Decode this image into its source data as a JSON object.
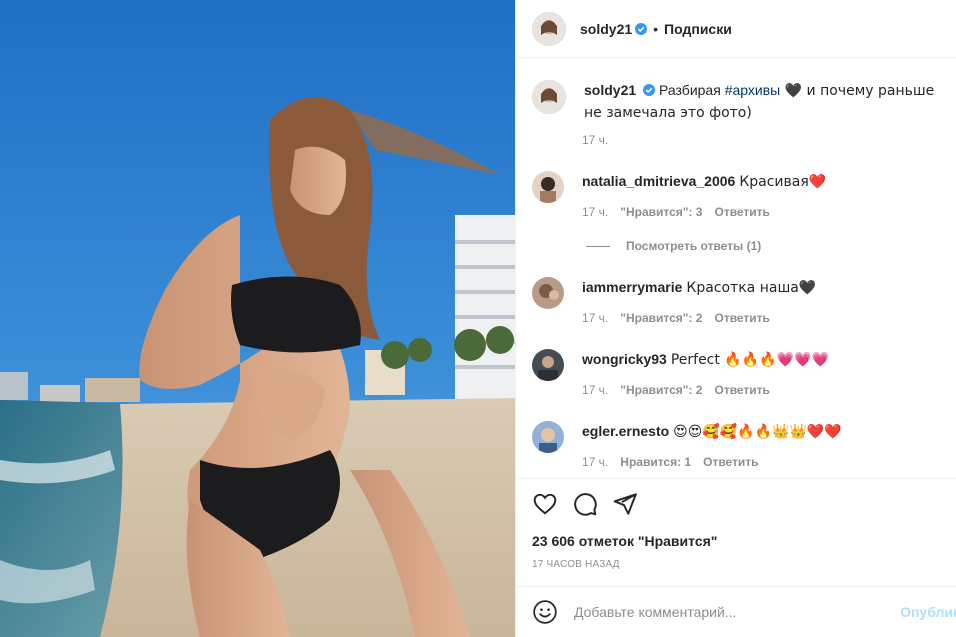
{
  "header": {
    "username": "soldy21",
    "dot": "•",
    "follow_label": "Подписки"
  },
  "caption": {
    "username": "soldy21",
    "text_before": " Разбирая ",
    "hashtag": "#архивы",
    "text_after": " 🖤 и почему раньше не замечала это фото)",
    "time": "17 ч."
  },
  "comments": [
    {
      "username": "natalia_dmitrieva_2006",
      "text": "Красивая❤️",
      "time": "17 ч.",
      "likes": "\"Нравится\": 3",
      "reply": "Ответить"
    },
    {
      "username": "iammerrymarie",
      "text": "Красотка наша🖤",
      "time": "17 ч.",
      "likes": "\"Нравится\": 2",
      "reply": "Ответить"
    },
    {
      "username": "wongricky93",
      "text": "Perfect 🔥🔥🔥💗💗💗",
      "time": "17 ч.",
      "likes": "\"Нравится\": 2",
      "reply": "Ответить"
    },
    {
      "username": "egler.ernesto",
      "text": "😍😍🥰🥰🔥🔥👑👑❤️❤️",
      "time": "17 ч.",
      "likes": "Нравится: 1",
      "reply": "Ответить"
    }
  ],
  "view_replies": "Посмотреть ответы (1)",
  "icons": {
    "like": "heart-icon",
    "comment": "comment-icon",
    "share": "share-icon",
    "emoji": "smile-icon",
    "verified": "verified-badge-icon"
  },
  "likes_count": "23 606 отметок \"Нравится\"",
  "timestamp": "17 ЧАСОВ НАЗАД",
  "add_comment": {
    "placeholder": "Добавьте комментарий...",
    "post_label": "Опублик"
  },
  "colors": {
    "verified": "#3897f0",
    "link": "#00376b",
    "post_disabled": "#b2dffc",
    "muted": "#8e8e8e"
  }
}
